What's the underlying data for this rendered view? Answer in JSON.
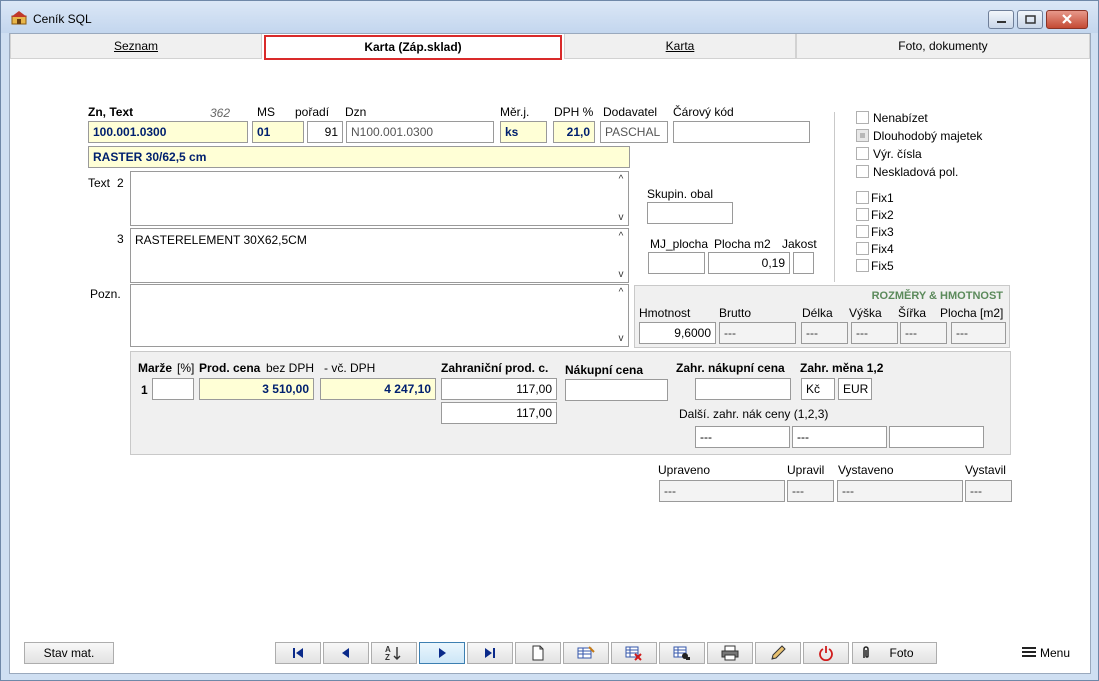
{
  "window": {
    "title": "Ceník SQL"
  },
  "tabs": [
    "Seznam",
    "Karta (Záp.sklad)",
    "Karta",
    "Foto, dokumenty"
  ],
  "header_labels": {
    "zn_text": "Zn, Text",
    "record_num": "362",
    "ms": "MS",
    "poradi": "pořadí",
    "dzn": "Dzn",
    "merj": "Měr.j.",
    "dph": "DPH %",
    "dodavatel": "Dodavatel",
    "carovy_kod": "Čárový kód"
  },
  "fields": {
    "zn": "100.001.0300",
    "ms": "01",
    "poradi": "91",
    "dzn": "N100.001.0300",
    "merj": "ks",
    "dph": "21,0",
    "dodavatel": "PASCHAL",
    "carovy_kod": "",
    "nazev": "RASTER  30/62,5 cm"
  },
  "text_area": {
    "text_label": "Text",
    "text2_num": "2",
    "text3_num": "3",
    "text2": "",
    "text3": "RASTERELEMENT 30X62,5CM",
    "pozn_label": "Pozn.",
    "pozn": ""
  },
  "middle": {
    "skupin_obal_label": "Skupin. obal",
    "skupin_obal": "",
    "mj_plocha_label": "MJ_plocha",
    "plocha_m2_label": "Plocha m2",
    "jakost_label": "Jakost",
    "mj_plocha": "",
    "plocha_m2": "0,19",
    "jakost": ""
  },
  "checkboxes": [
    {
      "label": "Nenabízet",
      "disabled": false
    },
    {
      "label": "Dlouhodobý majetek",
      "disabled": true
    },
    {
      "label": "Výr. čísla",
      "disabled": false
    },
    {
      "label": "Neskladová pol.",
      "disabled": false
    },
    {
      "label": "Fix1",
      "disabled": false
    },
    {
      "label": "Fix2",
      "disabled": false
    },
    {
      "label": "Fix3",
      "disabled": false
    },
    {
      "label": "Fix4",
      "disabled": false
    },
    {
      "label": "Fix5",
      "disabled": false
    }
  ],
  "dimensions": {
    "title": "ROZMĚRY & HMOTNOST",
    "labels": [
      "Hmotnost",
      "Brutto",
      "Délka",
      "Výška",
      "Šířka",
      "Plocha [m2]"
    ],
    "values": [
      "9,6000",
      "---",
      "---",
      "---",
      "---",
      "---"
    ]
  },
  "prices": {
    "marze_label": "Marže",
    "marze_unit": "[%]",
    "row_num": "1",
    "marze": "",
    "prod_cena_label": "Prod. cena",
    "bez_dph_label": "bez DPH",
    "vc_dph_label": "- vč. DPH",
    "bez_dph": "3 510,00",
    "vc_dph": "4 247,10",
    "zahr_prod_label": "Zahraniční prod. c.",
    "zahr_prod_1": "117,00",
    "zahr_prod_2": "117,00",
    "nakupni_label": "Nákupní cena",
    "nakupni": "",
    "zahr_nakupni_label": "Zahr. nákupní cena",
    "zahr_nakupni": "",
    "zahr_mena_label": "Zahr. měna 1,2",
    "mena_1": "Kč",
    "mena_2": "EUR",
    "dalsi_label": "Další. zahr. nák ceny (1,2,3)",
    "dalsi": [
      "---",
      "---",
      ""
    ]
  },
  "audit": {
    "labels": [
      "Upraveno",
      "Upravil",
      "Vystaveno",
      "Vystavil"
    ],
    "values": [
      "---",
      "---",
      "---",
      "---"
    ]
  },
  "bottom": {
    "stav_mat": "Stav mat.",
    "foto": "Foto",
    "menu": "Menu"
  },
  "colors": {
    "active_tab_border": "#d92a2a",
    "highlight_field": "#ffffd6",
    "dim_title": "#5b8a5b",
    "value_text": "#00206f"
  }
}
